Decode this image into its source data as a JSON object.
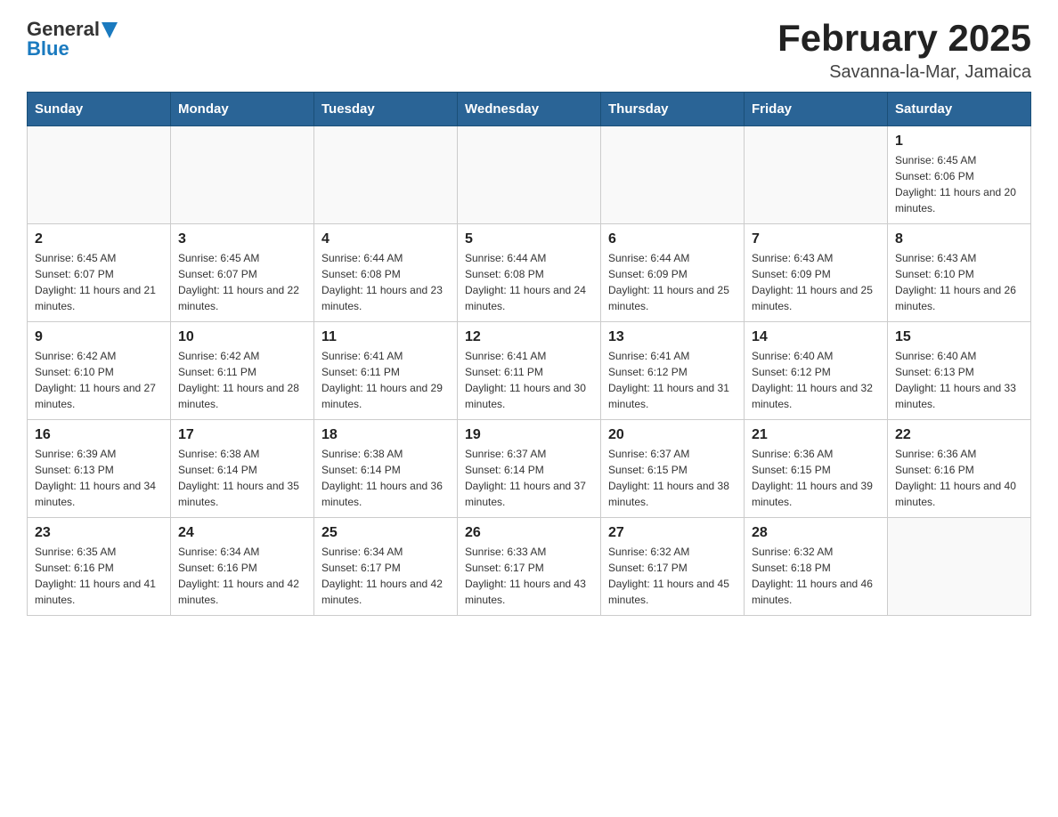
{
  "header": {
    "logo": {
      "general": "General",
      "blue": "Blue"
    },
    "title": "February 2025",
    "location": "Savanna-la-Mar, Jamaica"
  },
  "weekdays": [
    "Sunday",
    "Monday",
    "Tuesday",
    "Wednesday",
    "Thursday",
    "Friday",
    "Saturday"
  ],
  "weeks": [
    [
      {
        "day": "",
        "sunrise": "",
        "sunset": "",
        "daylight": ""
      },
      {
        "day": "",
        "sunrise": "",
        "sunset": "",
        "daylight": ""
      },
      {
        "day": "",
        "sunrise": "",
        "sunset": "",
        "daylight": ""
      },
      {
        "day": "",
        "sunrise": "",
        "sunset": "",
        "daylight": ""
      },
      {
        "day": "",
        "sunrise": "",
        "sunset": "",
        "daylight": ""
      },
      {
        "day": "",
        "sunrise": "",
        "sunset": "",
        "daylight": ""
      },
      {
        "day": "1",
        "sunrise": "Sunrise: 6:45 AM",
        "sunset": "Sunset: 6:06 PM",
        "daylight": "Daylight: 11 hours and 20 minutes."
      }
    ],
    [
      {
        "day": "2",
        "sunrise": "Sunrise: 6:45 AM",
        "sunset": "Sunset: 6:07 PM",
        "daylight": "Daylight: 11 hours and 21 minutes."
      },
      {
        "day": "3",
        "sunrise": "Sunrise: 6:45 AM",
        "sunset": "Sunset: 6:07 PM",
        "daylight": "Daylight: 11 hours and 22 minutes."
      },
      {
        "day": "4",
        "sunrise": "Sunrise: 6:44 AM",
        "sunset": "Sunset: 6:08 PM",
        "daylight": "Daylight: 11 hours and 23 minutes."
      },
      {
        "day": "5",
        "sunrise": "Sunrise: 6:44 AM",
        "sunset": "Sunset: 6:08 PM",
        "daylight": "Daylight: 11 hours and 24 minutes."
      },
      {
        "day": "6",
        "sunrise": "Sunrise: 6:44 AM",
        "sunset": "Sunset: 6:09 PM",
        "daylight": "Daylight: 11 hours and 25 minutes."
      },
      {
        "day": "7",
        "sunrise": "Sunrise: 6:43 AM",
        "sunset": "Sunset: 6:09 PM",
        "daylight": "Daylight: 11 hours and 25 minutes."
      },
      {
        "day": "8",
        "sunrise": "Sunrise: 6:43 AM",
        "sunset": "Sunset: 6:10 PM",
        "daylight": "Daylight: 11 hours and 26 minutes."
      }
    ],
    [
      {
        "day": "9",
        "sunrise": "Sunrise: 6:42 AM",
        "sunset": "Sunset: 6:10 PM",
        "daylight": "Daylight: 11 hours and 27 minutes."
      },
      {
        "day": "10",
        "sunrise": "Sunrise: 6:42 AM",
        "sunset": "Sunset: 6:11 PM",
        "daylight": "Daylight: 11 hours and 28 minutes."
      },
      {
        "day": "11",
        "sunrise": "Sunrise: 6:41 AM",
        "sunset": "Sunset: 6:11 PM",
        "daylight": "Daylight: 11 hours and 29 minutes."
      },
      {
        "day": "12",
        "sunrise": "Sunrise: 6:41 AM",
        "sunset": "Sunset: 6:11 PM",
        "daylight": "Daylight: 11 hours and 30 minutes."
      },
      {
        "day": "13",
        "sunrise": "Sunrise: 6:41 AM",
        "sunset": "Sunset: 6:12 PM",
        "daylight": "Daylight: 11 hours and 31 minutes."
      },
      {
        "day": "14",
        "sunrise": "Sunrise: 6:40 AM",
        "sunset": "Sunset: 6:12 PM",
        "daylight": "Daylight: 11 hours and 32 minutes."
      },
      {
        "day": "15",
        "sunrise": "Sunrise: 6:40 AM",
        "sunset": "Sunset: 6:13 PM",
        "daylight": "Daylight: 11 hours and 33 minutes."
      }
    ],
    [
      {
        "day": "16",
        "sunrise": "Sunrise: 6:39 AM",
        "sunset": "Sunset: 6:13 PM",
        "daylight": "Daylight: 11 hours and 34 minutes."
      },
      {
        "day": "17",
        "sunrise": "Sunrise: 6:38 AM",
        "sunset": "Sunset: 6:14 PM",
        "daylight": "Daylight: 11 hours and 35 minutes."
      },
      {
        "day": "18",
        "sunrise": "Sunrise: 6:38 AM",
        "sunset": "Sunset: 6:14 PM",
        "daylight": "Daylight: 11 hours and 36 minutes."
      },
      {
        "day": "19",
        "sunrise": "Sunrise: 6:37 AM",
        "sunset": "Sunset: 6:14 PM",
        "daylight": "Daylight: 11 hours and 37 minutes."
      },
      {
        "day": "20",
        "sunrise": "Sunrise: 6:37 AM",
        "sunset": "Sunset: 6:15 PM",
        "daylight": "Daylight: 11 hours and 38 minutes."
      },
      {
        "day": "21",
        "sunrise": "Sunrise: 6:36 AM",
        "sunset": "Sunset: 6:15 PM",
        "daylight": "Daylight: 11 hours and 39 minutes."
      },
      {
        "day": "22",
        "sunrise": "Sunrise: 6:36 AM",
        "sunset": "Sunset: 6:16 PM",
        "daylight": "Daylight: 11 hours and 40 minutes."
      }
    ],
    [
      {
        "day": "23",
        "sunrise": "Sunrise: 6:35 AM",
        "sunset": "Sunset: 6:16 PM",
        "daylight": "Daylight: 11 hours and 41 minutes."
      },
      {
        "day": "24",
        "sunrise": "Sunrise: 6:34 AM",
        "sunset": "Sunset: 6:16 PM",
        "daylight": "Daylight: 11 hours and 42 minutes."
      },
      {
        "day": "25",
        "sunrise": "Sunrise: 6:34 AM",
        "sunset": "Sunset: 6:17 PM",
        "daylight": "Daylight: 11 hours and 42 minutes."
      },
      {
        "day": "26",
        "sunrise": "Sunrise: 6:33 AM",
        "sunset": "Sunset: 6:17 PM",
        "daylight": "Daylight: 11 hours and 43 minutes."
      },
      {
        "day": "27",
        "sunrise": "Sunrise: 6:32 AM",
        "sunset": "Sunset: 6:17 PM",
        "daylight": "Daylight: 11 hours and 45 minutes."
      },
      {
        "day": "28",
        "sunrise": "Sunrise: 6:32 AM",
        "sunset": "Sunset: 6:18 PM",
        "daylight": "Daylight: 11 hours and 46 minutes."
      },
      {
        "day": "",
        "sunrise": "",
        "sunset": "",
        "daylight": ""
      }
    ]
  ]
}
